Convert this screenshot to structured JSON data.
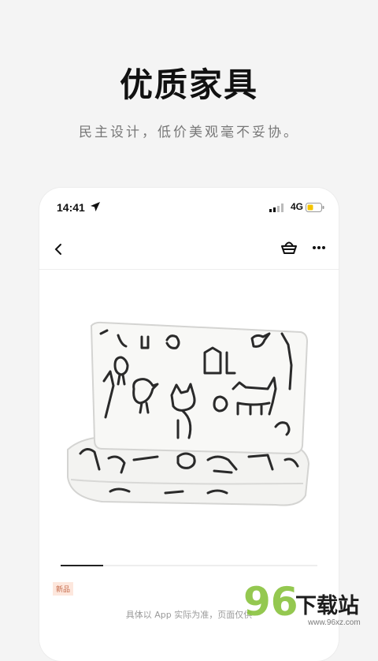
{
  "promo": {
    "headline": "优质家具",
    "subline": "民主设计，低价美观毫不妥协。"
  },
  "status": {
    "time": "14:41",
    "network": "4G",
    "battery_color": "#f5c400"
  },
  "nav": {
    "back_icon": "chevron-left-icon",
    "basket_icon": "basket-icon",
    "more_icon": "ellipsis-icon"
  },
  "product": {
    "badge": "新品",
    "disclaimer": "具体以 App 实际为准，页面仅供"
  },
  "watermark": {
    "number": "96",
    "title": "下载站",
    "url": "www.96xz.com"
  },
  "colors": {
    "background": "#f4f4f4",
    "badge_bg": "#fde7dd",
    "badge_text": "#c56a4a",
    "watermark_green": "#8cc442"
  }
}
